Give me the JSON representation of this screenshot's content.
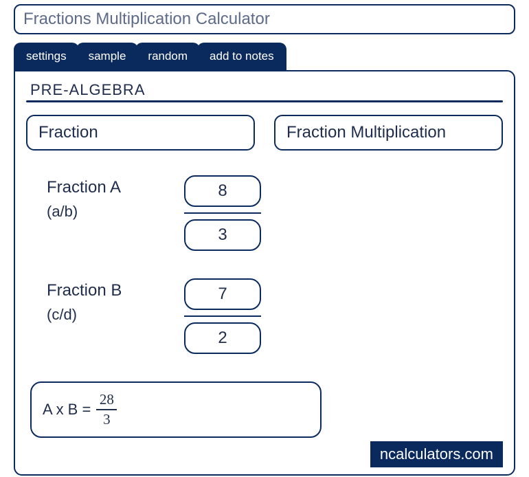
{
  "title": "Fractions Multiplication Calculator",
  "tabs": {
    "settings": "settings",
    "sample": "sample",
    "random": "random",
    "add": "add to notes"
  },
  "section_title": "PRE-ALGEBRA",
  "chips": {
    "fraction": "Fraction",
    "mult": "Fraction Multiplication"
  },
  "labels": {
    "a": "Fraction A",
    "a_sub": "(a/b)",
    "b": "Fraction B",
    "b_sub": "(c/d)"
  },
  "values": {
    "a_num": "8",
    "a_den": "3",
    "b_num": "7",
    "b_den": "2"
  },
  "result": {
    "prefix": "A x B  =",
    "num": "28",
    "den": "3"
  },
  "brand": "ncalculators.com"
}
